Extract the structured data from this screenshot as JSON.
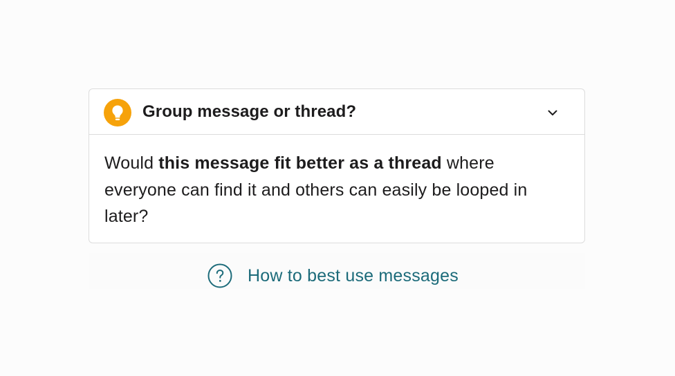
{
  "card": {
    "title": "Group message or thread?",
    "icon": "lightbulb-icon",
    "toggle_icon": "chevron-down-icon",
    "body": {
      "text_before": "Would ",
      "text_bold": "this message fit better as a thread",
      "text_after": " where everyone can find it and others can easily be looped in later?"
    }
  },
  "help": {
    "icon": "question-circle-icon",
    "link_label": "How to best use messages"
  },
  "colors": {
    "accent_orange": "#f6a20a",
    "link_teal": "#1c6b7a",
    "text": "#1d1c1d",
    "border": "#dcdcdc"
  }
}
